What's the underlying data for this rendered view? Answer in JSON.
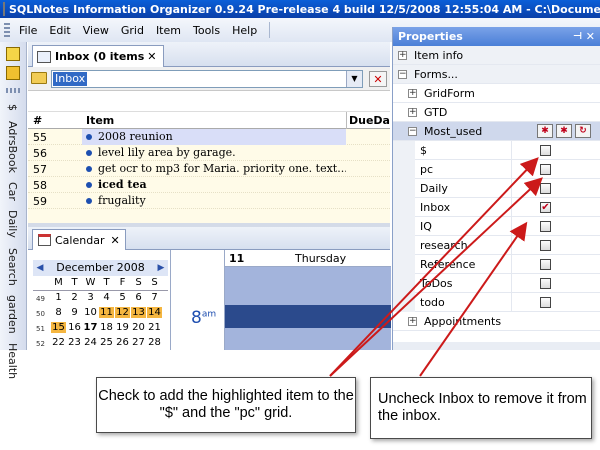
{
  "titlebar": {
    "title": "SQLNotes Information Organizer 0.9.24 Pre-release 4  build 12/5/2008 12:55:04 AM - C:\\Documents and"
  },
  "menu": {
    "items": [
      "File",
      "Edit",
      "View",
      "Grid",
      "Item",
      "Tools",
      "Help"
    ]
  },
  "left_toolbar": {
    "vertical_grids": [
      "$",
      "AdrsBook",
      "Car",
      "Daily",
      "Search",
      "garden",
      "Health"
    ]
  },
  "inbox_tab": {
    "label": "Inbox (0 items",
    "close": "✕"
  },
  "filter": {
    "value": "Inbox",
    "dropdown_glyph": "▼",
    "clear_glyph": "✕"
  },
  "grid": {
    "headers": {
      "num": "#",
      "item": "Item",
      "due": "DueDat"
    },
    "rows": [
      {
        "num": "55",
        "item": "2008 reunion",
        "bold": false,
        "selected": true
      },
      {
        "num": "56",
        "item": "level lily area by garage.",
        "bold": false,
        "selected": false
      },
      {
        "num": "57",
        "item": "get ocr to mp3 for Maria. priority one. text...",
        "bold": false,
        "selected": false
      },
      {
        "num": "58",
        "item": "iced tea",
        "bold": true,
        "selected": false
      },
      {
        "num": "59",
        "item": "frugality",
        "bold": false,
        "selected": false
      }
    ]
  },
  "calendar_tab": {
    "label": "Calendar",
    "close": "✕"
  },
  "month": {
    "title": "December 2008",
    "prev": "◀",
    "next": "▶",
    "dow": [
      "M",
      "T",
      "W",
      "T",
      "F",
      "S",
      "S"
    ],
    "weeks": [
      {
        "wk": "49",
        "days": [
          "1",
          "2",
          "3",
          "4",
          "5",
          "6",
          "7"
        ]
      },
      {
        "wk": "50",
        "days": [
          "8",
          "9",
          "10",
          "11",
          "12",
          "13",
          "14"
        ]
      },
      {
        "wk": "51",
        "days": [
          "15",
          "16",
          "17",
          "18",
          "19",
          "20",
          "21"
        ]
      },
      {
        "wk": "52",
        "days": [
          "22",
          "23",
          "24",
          "25",
          "26",
          "27",
          "28"
        ]
      }
    ]
  },
  "dayview": {
    "daynum": "11",
    "dayname": "Thursday",
    "hour": "8",
    "ampm": "am"
  },
  "properties": {
    "title": "Properties",
    "pin": "⊣",
    "close": "✕",
    "rows": [
      {
        "kind": "cat",
        "label": "Item info",
        "exp": "+"
      },
      {
        "kind": "cat",
        "label": "Forms...",
        "exp": "−"
      },
      {
        "kind": "sub",
        "label": "GridForm",
        "exp": "+"
      },
      {
        "kind": "sub",
        "label": "GTD",
        "exp": "+"
      },
      {
        "kind": "mostused",
        "label": "Most_used",
        "exp": "−"
      },
      {
        "kind": "field",
        "label": "$",
        "checked": false
      },
      {
        "kind": "field",
        "label": "pc",
        "checked": false
      },
      {
        "kind": "field",
        "label": "Daily",
        "checked": false
      },
      {
        "kind": "field",
        "label": "Inbox",
        "checked": true
      },
      {
        "kind": "field",
        "label": "IQ",
        "checked": false
      },
      {
        "kind": "field",
        "label": "research",
        "checked": false
      },
      {
        "kind": "field",
        "label": "Reference",
        "checked": false
      },
      {
        "kind": "field",
        "label": "ToDos",
        "checked": false
      },
      {
        "kind": "field",
        "label": "todo",
        "checked": false
      },
      {
        "kind": "sub",
        "label": "Appointments",
        "exp": "+"
      }
    ],
    "check_glyph": "✔"
  },
  "callouts": {
    "left": "Check to add the highlighted item to the \"$\" and the \"pc\" grid.",
    "right": "Uncheck Inbox to remove it from the inbox."
  },
  "colors": {
    "arrow": "#cc1a1a",
    "titlebar": "#0a4fc8",
    "selected_row": "#d9def8",
    "highlight_day": "#f5b640"
  }
}
